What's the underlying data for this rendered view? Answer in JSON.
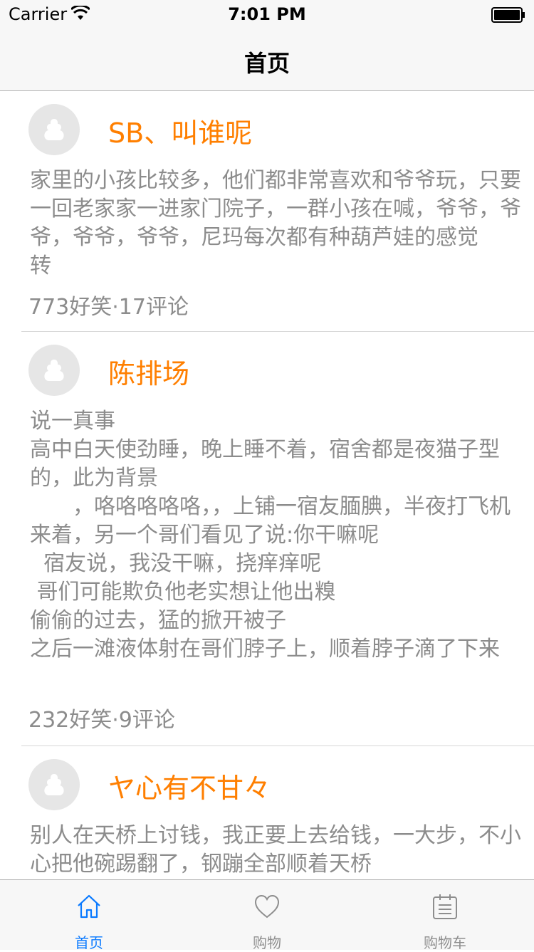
{
  "status_bar": {
    "carrier": "Carrier",
    "time": "7:01 PM"
  },
  "nav": {
    "title": "首页"
  },
  "colors": {
    "accent": "#0a7aff",
    "author": "#ff7f00",
    "body_text": "#8c8c8c"
  },
  "posts": [
    {
      "author": "SB、叫谁呢",
      "content": "家里的小孩比较多，他们都非常喜欢和爷爷玩，只要一回老家家一进家门院子，一群小孩在喊，爷爷，爷爷，爷爷，爷爷，尼玛每次都有种葫芦娃的感觉 　　　转",
      "stats": "773好笑·17评论"
    },
    {
      "author": "陈排场",
      "content": "说一真事\n高中白天使劲睡，晚上睡不着，宿舍都是夜猫子型的，此为背景\n　　，咯咯咯咯咯，，上铺一宿友腼腆，半夜打飞机来着，另一个哥们看见了说:你干嘛呢\n  宿友说，我没干嘛，挠痒痒呢\n 哥们可能欺负他老实想让他出糗\n偷偷的过去，猛的掀开被子\n之后一滩液体射在哥们脖子上，顺着脖子滴了下来",
      "stats": "232好笑·9评论"
    },
    {
      "author": "ヤ心有不甘々",
      "content": "别人在天桥上讨钱，我正要上去给钱，一大步，不小心把他碗踢翻了，钢蹦全部顺着天桥",
      "stats": ""
    }
  ],
  "tabs": [
    {
      "label": "首页",
      "icon": "home-icon",
      "active": true
    },
    {
      "label": "购物",
      "icon": "heart-icon",
      "active": false
    },
    {
      "label": "购物车",
      "icon": "list-icon",
      "active": false
    }
  ]
}
